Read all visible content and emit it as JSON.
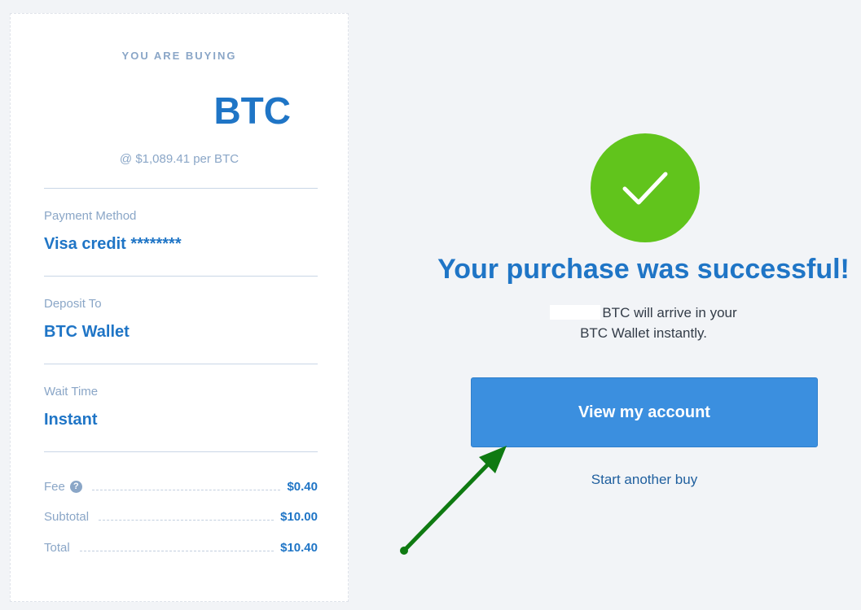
{
  "summary": {
    "buying_label": "YOU ARE BUYING",
    "amount": "BTC",
    "rate": "@ $1,089.41 per BTC",
    "payment_method_label": "Payment Method",
    "payment_method_value": "Visa credit ********",
    "deposit_label": "Deposit To",
    "deposit_value": "BTC Wallet",
    "wait_label": "Wait Time",
    "wait_value": "Instant",
    "fee_label": "Fee",
    "fee_value": "$0.40",
    "subtotal_label": "Subtotal",
    "subtotal_value": "$10.00",
    "total_label": "Total",
    "total_value": "$10.40",
    "help_icon_glyph": "?"
  },
  "confirmation": {
    "title": "Your purchase was successful!",
    "message_line1": "BTC will arrive in your",
    "message_line2": "BTC Wallet instantly.",
    "view_account_button": "View my account",
    "start_another_link": "Start another buy"
  },
  "icons": {
    "success": "checkmark-icon",
    "help": "question-circle-icon",
    "annotation": "green-arrow-annotation"
  },
  "colors": {
    "accent_blue": "#1f75c6",
    "button_blue": "#3b8fdf",
    "success_green": "#61c41c",
    "annotation_green": "#0f7a12",
    "muted_label": "#8aa6c7"
  }
}
